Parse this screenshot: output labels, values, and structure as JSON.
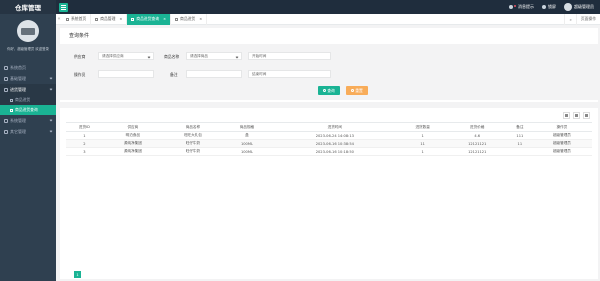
{
  "app": {
    "title": "仓库管理"
  },
  "topbar": {
    "items": [
      {
        "label": "消息提示"
      },
      {
        "label": "锁屏"
      },
      {
        "label": "超级管理员"
      }
    ]
  },
  "sidebar": {
    "profile_text": "你好，超级管理员 欢迎登录",
    "menu": [
      {
        "label": "系统首页"
      },
      {
        "label": "基础管理"
      },
      {
        "label": "进货管理"
      }
    ],
    "sub": [
      {
        "label": "商品进货"
      },
      {
        "label": "商品进货查询"
      }
    ],
    "menu_after": [
      {
        "label": "系统管理"
      },
      {
        "label": "其它管理"
      }
    ]
  },
  "tabs": {
    "items": [
      {
        "label": "系统首页"
      },
      {
        "label": "商品管理"
      },
      {
        "label": "商品进货查询"
      },
      {
        "label": "商品进货"
      }
    ],
    "right": {
      "refresh": "页面操作"
    }
  },
  "search": {
    "title": "查询条件",
    "fields": {
      "provider_label": "供应商",
      "provider_value": "请选择供应商",
      "goods_label": "商品名称",
      "goods_value": "请选择商品",
      "start_label": "开始时间",
      "operator_label": "操作员",
      "remark_label": "备注",
      "end_label": "结束时间"
    },
    "buttons": {
      "search": "查询",
      "reset": "重置"
    }
  },
  "table": {
    "headers": [
      "进货ID",
      "供应商",
      "商品名称",
      "商品规格",
      "进货时间",
      "进货数量",
      "进货价格",
      "备注",
      "操作员"
    ],
    "rows": [
      [
        "1",
        "明泊食品",
        "旺旺大礼包",
        "盒",
        "2023-06-24 14:08:13",
        "1",
        "4.6",
        "111",
        "超级管理员"
      ],
      [
        "2",
        "源纯净集团",
        "旺仔牛奶",
        "100ML",
        "2023-06-16 10:38:54",
        "11",
        "12121121",
        "11",
        "超级管理员"
      ],
      [
        "3",
        "源纯净集团",
        "旺仔牛奶",
        "100ML",
        "2023-06-16 10:18:50",
        "1",
        "12121121",
        "",
        "超级管理员"
      ]
    ]
  },
  "pager": {
    "current": "1"
  }
}
